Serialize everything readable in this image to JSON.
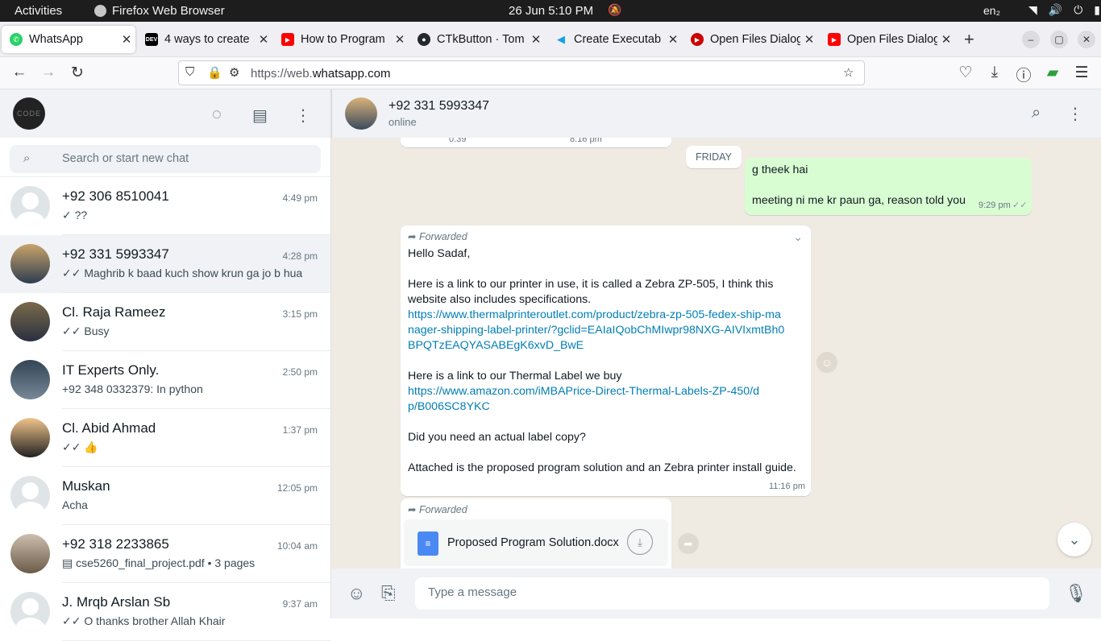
{
  "system": {
    "activities": "Activities",
    "app": "Firefox Web Browser",
    "clock": "26 Jun  5:10 PM",
    "lang": "en₂"
  },
  "tabs": [
    {
      "label": "WhatsApp",
      "icon": "whatsapp-icon"
    },
    {
      "label": "4 ways to create",
      "icon": "dev-icon"
    },
    {
      "label": "How to Program",
      "icon": "youtube-icon"
    },
    {
      "label": "CTkButton · Tom",
      "icon": "github-icon"
    },
    {
      "label": "Create Executab",
      "icon": "fish-icon"
    },
    {
      "label": "Open Files Dialog",
      "icon": "youtube-circle-icon"
    },
    {
      "label": "Open Files Dialog",
      "icon": "youtube-icon"
    }
  ],
  "url": {
    "prefix": "https://web.",
    "domain": "whatsapp.com"
  },
  "sidebar": {
    "avatar_text": "CODE",
    "search_placeholder": "Search or start new chat",
    "chats": [
      {
        "name": "+92 306 8510041",
        "time": "4:49 pm",
        "preview": "✓ ??"
      },
      {
        "name": "+92 331 5993347",
        "time": "4:28 pm",
        "preview": "✓✓ Maghrib k baad kuch show krun ga jo b hua"
      },
      {
        "name": "Cl. Raja Rameez",
        "time": "3:15 pm",
        "preview": "✓✓ Busy"
      },
      {
        "name": "IT Experts Only.",
        "time": "2:50 pm",
        "preview": "+92 348 0332379: In python"
      },
      {
        "name": "Cl. Abid Ahmad",
        "time": "1:37 pm",
        "preview": "✓✓ 👍"
      },
      {
        "name": "Muskan",
        "time": "12:05 pm",
        "preview": "Acha"
      },
      {
        "name": "+92 318 2233865",
        "time": "10:04 am",
        "preview": "▤ cse5260_final_project.pdf • 3 pages"
      },
      {
        "name": "J. Mrqb Arslan Sb",
        "time": "9:37 am",
        "preview": "✓✓ O thanks brother Allah Khair"
      }
    ]
  },
  "conversation": {
    "name": "+92 331 5993347",
    "status": "online",
    "top_stub_left": "0:39",
    "top_stub_right": "8:16 pm",
    "day": "FRIDAY",
    "out_line1": "g theek hai",
    "out_line2": "meeting ni me kr paun ga, reason told you",
    "out_time": "9:29 pm",
    "forwarded": "Forwarded",
    "fwd_greeting": "Hello Sadaf,",
    "fwd_p1": "Here is a link to our printer in use, it is called a Zebra ZP-505, I think this website also includes specifications.",
    "fwd_link1": "https://www.thermalprinteroutlet.com/product/zebra-zp-505-fedex-ship-manager-shipping-label-printer/?gclid=EAIaIQobChMIwpr98NXG-AIVIxmtBh0BPQTzEAQYASABEgK6xvD_BwE",
    "fwd_p2": "Here is a link to our Thermal Label we buy",
    "fwd_link2": "https://www.amazon.com/iMBAPrice-Direct-Thermal-Labels-ZP-450/dp/B006SC8YKC",
    "fwd_p3": "Did you need an actual label copy?",
    "fwd_p4": "Attached is the proposed program solution and an Zebra printer install guide.",
    "fwd_time": "11:16 pm",
    "doc_name": "Proposed Program Solution.docx"
  },
  "composer": {
    "placeholder": "Type a message"
  }
}
